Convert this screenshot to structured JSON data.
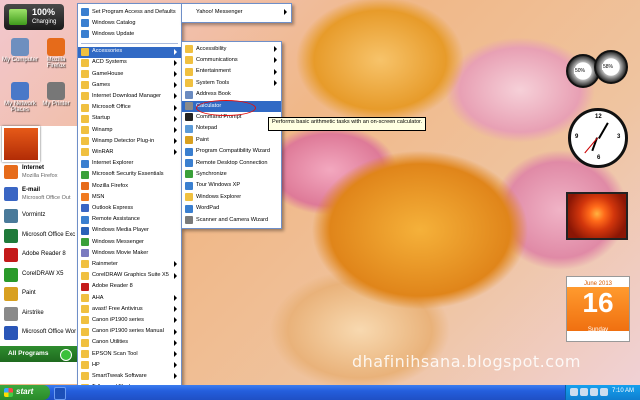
{
  "battery": {
    "percent": "100%",
    "status": "Charging"
  },
  "desktop_icons": [
    {
      "label": "My Computer",
      "color": "#6e8fbf"
    },
    {
      "label": "Mozilla Firefox",
      "color": "#e66b1a"
    },
    {
      "label": "My Network Places",
      "color": "#4a78c8"
    },
    {
      "label": "My Printer",
      "color": "#777777"
    }
  ],
  "start_menu": {
    "pinned": [
      {
        "title": "Internet",
        "subtitle": "Mozilla Firefox",
        "icon": "firefox-icon",
        "color": "#e66b1a"
      },
      {
        "title": "E-mail",
        "subtitle": "Microsoft Office Out",
        "icon": "mail-icon",
        "color": "#3a66c4"
      }
    ],
    "recent": [
      {
        "label": "Vormintz",
        "icon": "vormintz-icon",
        "color": "#4a7a9a"
      },
      {
        "label": "Microsoft Office Exc",
        "icon": "excel-icon",
        "color": "#1f7a3a"
      },
      {
        "label": "Adobe Reader 8",
        "icon": "acrobat-icon",
        "color": "#c41a1a"
      },
      {
        "label": "CorelDRAW X5",
        "icon": "corel-icon",
        "color": "#2a9a2a"
      },
      {
        "label": "Paint",
        "icon": "paint-icon",
        "color": "#d8a020"
      },
      {
        "label": "Airstrike",
        "icon": "airstrike-icon",
        "color": "#8a8a8a"
      },
      {
        "label": "Microsoft Office Wor",
        "icon": "word-icon",
        "color": "#2a56b8"
      }
    ],
    "all_programs_label": "All Programs"
  },
  "programs_menu": [
    {
      "label": "Set Program Access and Defaults",
      "submenu": false,
      "color": "#3a7fd0"
    },
    {
      "label": "Windows Catalog",
      "submenu": false,
      "color": "#3a7fd0"
    },
    {
      "label": "Windows Update",
      "submenu": false,
      "color": "#3a7fd0"
    },
    {
      "sep": true
    },
    {
      "label": "Accessories",
      "submenu": true,
      "highlight": true,
      "color": "#f0c040"
    },
    {
      "label": "ACD Systems",
      "submenu": true,
      "color": "#f0c040"
    },
    {
      "label": "GameHouse",
      "submenu": true,
      "color": "#f0c040"
    },
    {
      "label": "Games",
      "submenu": true,
      "color": "#f0c040"
    },
    {
      "label": "Internet Download Manager",
      "submenu": true,
      "color": "#f0c040"
    },
    {
      "label": "Microsoft Office",
      "submenu": true,
      "color": "#f0c040"
    },
    {
      "label": "Startup",
      "submenu": true,
      "color": "#f0c040"
    },
    {
      "label": "Winamp",
      "submenu": true,
      "color": "#f0c040"
    },
    {
      "label": "Winamp Detector Plug-in",
      "submenu": true,
      "color": "#f0c040"
    },
    {
      "label": "WinRAR",
      "submenu": true,
      "color": "#f0c040"
    },
    {
      "label": "Internet Explorer",
      "submenu": false,
      "color": "#3a7fd0"
    },
    {
      "label": "Microsoft Security Essentials",
      "submenu": false,
      "color": "#3aa03a"
    },
    {
      "label": "Mozilla Firefox",
      "submenu": false,
      "color": "#e66b1a"
    },
    {
      "label": "MSN",
      "submenu": false,
      "color": "#f07a20"
    },
    {
      "label": "Outlook Express",
      "submenu": false,
      "color": "#3a66c4"
    },
    {
      "label": "Remote Assistance",
      "submenu": false,
      "color": "#3a7fd0"
    },
    {
      "label": "Windows Media Player",
      "submenu": false,
      "color": "#2a62b8"
    },
    {
      "label": "Windows Messenger",
      "submenu": false,
      "color": "#3aa03a"
    },
    {
      "label": "Windows Movie Maker",
      "submenu": false,
      "color": "#7a7ac0"
    },
    {
      "label": "Rainmeter",
      "submenu": true,
      "color": "#f0c040"
    },
    {
      "label": "CorelDRAW Graphics Suite X5",
      "submenu": true,
      "color": "#f0c040"
    },
    {
      "label": "Adobe Reader 8",
      "submenu": false,
      "color": "#c41a1a"
    },
    {
      "label": "AHA",
      "submenu": true,
      "color": "#f0c040"
    },
    {
      "label": "avast! Free Antivirus",
      "submenu": true,
      "color": "#f0c040"
    },
    {
      "label": "Canon iP1900 series",
      "submenu": true,
      "color": "#f0c040"
    },
    {
      "label": "Canon iP1900 series Manual",
      "submenu": true,
      "color": "#f0c040"
    },
    {
      "label": "Canon Utilities",
      "submenu": true,
      "color": "#f0c040"
    },
    {
      "label": "EPSON Scan Tool",
      "submenu": true,
      "color": "#f0c040"
    },
    {
      "label": "HP",
      "submenu": true,
      "color": "#f0c040"
    },
    {
      "label": "SmartTweak Software",
      "submenu": true,
      "color": "#f0c040"
    },
    {
      "label": "Telkomsel Flash",
      "submenu": true,
      "color": "#f0c040"
    }
  ],
  "top_submenu": {
    "label": "Yahoo! Messenger",
    "submenu": true,
    "color": "#7a3ab8"
  },
  "accessories_menu": [
    {
      "label": "Accessibility",
      "submenu": true,
      "color": "#f0c040"
    },
    {
      "label": "Communications",
      "submenu": true,
      "color": "#f0c040"
    },
    {
      "label": "Entertainment",
      "submenu": true,
      "color": "#f0c040"
    },
    {
      "label": "System Tools",
      "submenu": true,
      "color": "#f0c040"
    },
    {
      "label": "Address Book",
      "submenu": false,
      "color": "#6a8ac0"
    },
    {
      "label": "Calculator",
      "submenu": false,
      "highlight": true,
      "color": "#8a8a8a"
    },
    {
      "label": "Command Prompt",
      "submenu": false,
      "color": "#222222"
    },
    {
      "label": "Notepad",
      "submenu": false,
      "color": "#5a9ad8"
    },
    {
      "label": "Paint",
      "submenu": false,
      "color": "#d8a020"
    },
    {
      "label": "Program Compatibility Wizard",
      "submenu": false,
      "color": "#3a7fd0"
    },
    {
      "label": "Remote Desktop Connection",
      "submenu": false,
      "color": "#3a7fd0"
    },
    {
      "label": "Synchronize",
      "submenu": false,
      "color": "#3aa03a"
    },
    {
      "label": "Tour Windows XP",
      "submenu": false,
      "color": "#3a7fd0"
    },
    {
      "label": "Windows Explorer",
      "submenu": false,
      "color": "#f0c040"
    },
    {
      "label": "WordPad",
      "submenu": false,
      "color": "#3a7fd0"
    },
    {
      "label": "Scanner and Camera Wizard",
      "submenu": false,
      "color": "#7a7a7a"
    }
  ],
  "tooltip": "Performs basic arithmetic tasks with an on-screen calculator.",
  "gadgets": {
    "meter_cpu": "50%",
    "meter_mem": "58%",
    "clock_numbers": [
      "12",
      "3",
      "6",
      "9"
    ],
    "calendar": {
      "month": "June 2013",
      "day": "16",
      "weekday": "Sunday"
    }
  },
  "watermark": "dhafinihsana.blogspot.com",
  "taskbar": {
    "start_label": "start",
    "time": "7:10 AM"
  }
}
